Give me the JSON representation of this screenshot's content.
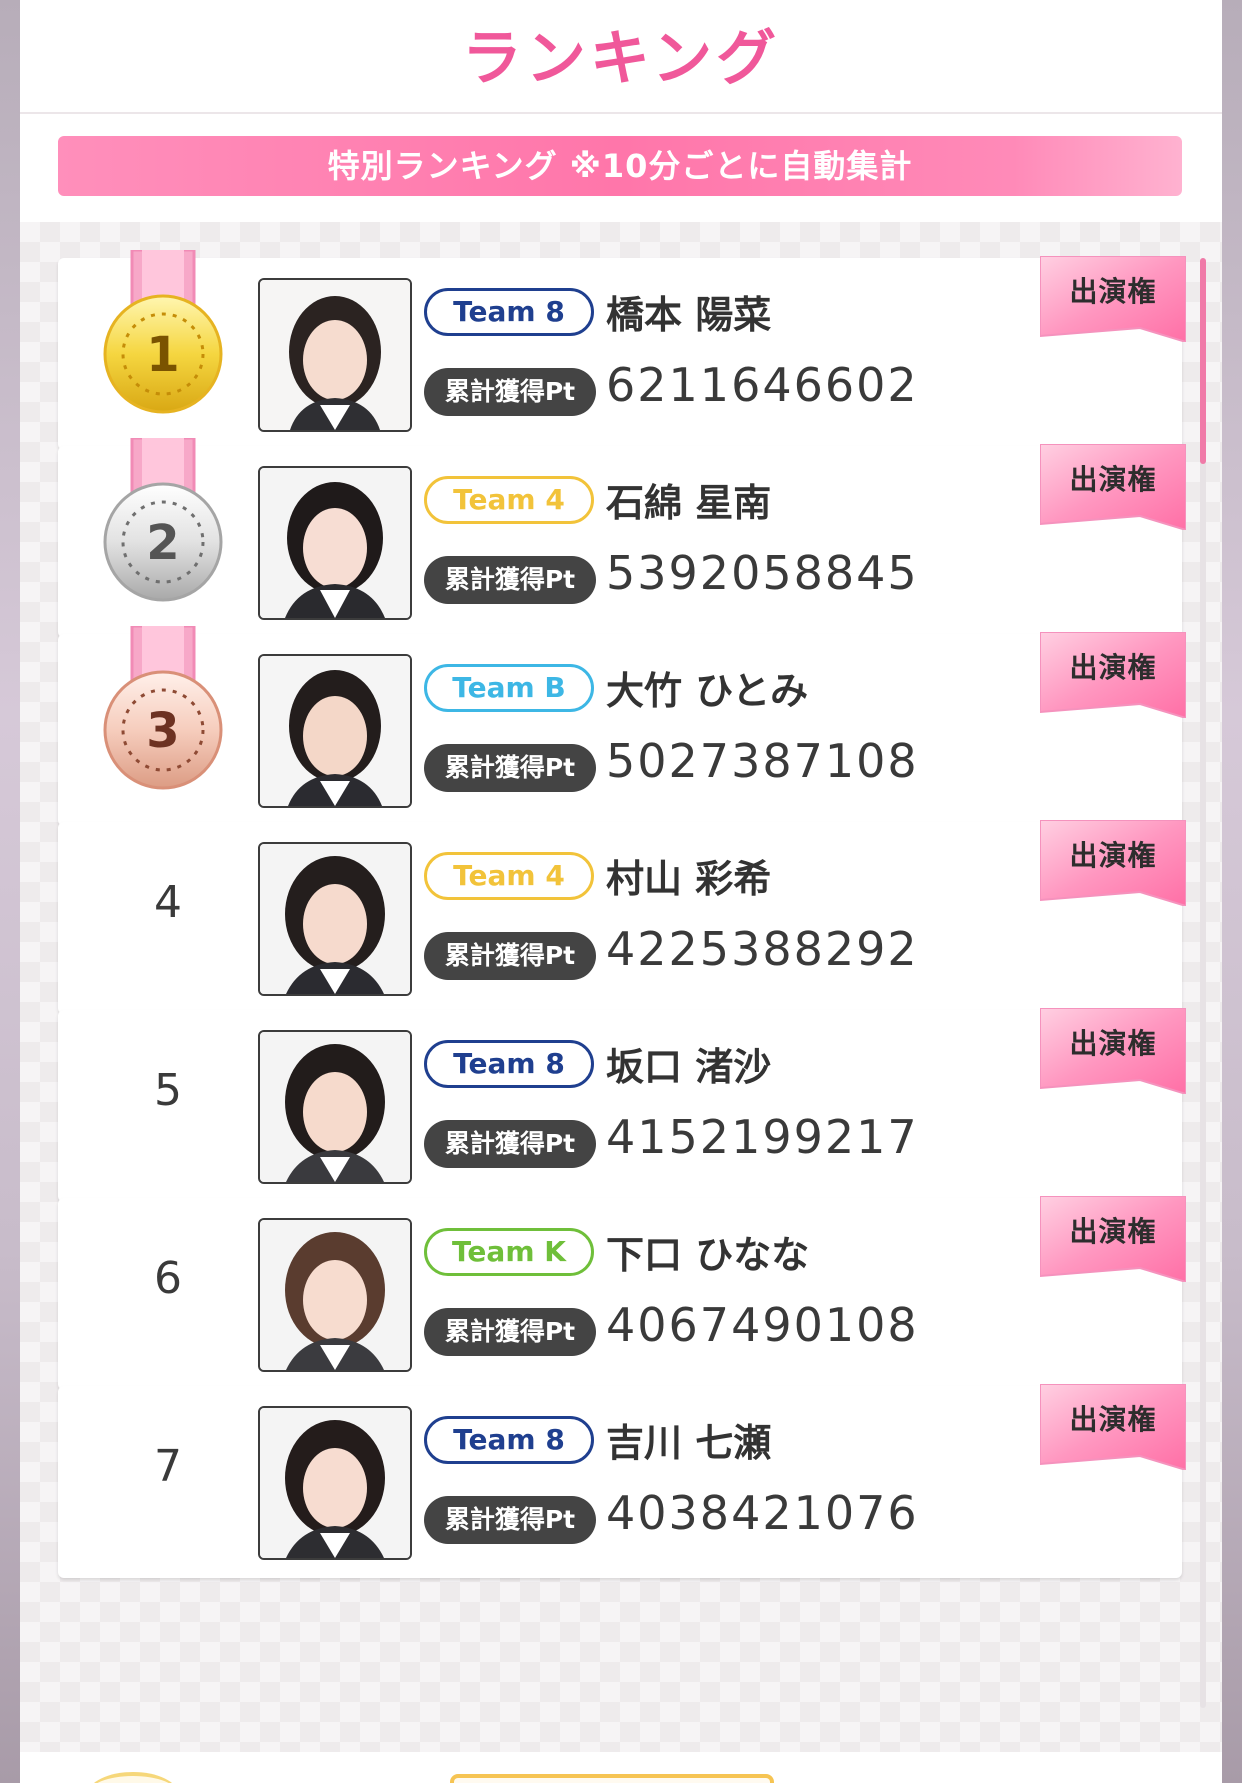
{
  "header": {
    "title": "ランキング"
  },
  "subheader": {
    "text": "特別ランキング ※10分ごとに自動集計"
  },
  "colors": {
    "accent_pink": "#f0589a",
    "team_8": "#1f3f8f",
    "team_4": "#f2c33a",
    "team_b": "#3db7e5",
    "team_k": "#6fbf3a"
  },
  "ranking": [
    {
      "rank": "1",
      "medal": "gold-medal-icon",
      "team": "Team 8",
      "name": "橋本 陽菜",
      "pt_label": "累計獲得Pt",
      "points": "6211646602",
      "ribbon": "出演権"
    },
    {
      "rank": "2",
      "medal": "silver-medal-icon",
      "team": "Team 4",
      "name": "石綿 星南",
      "pt_label": "累計獲得Pt",
      "points": "5392058845",
      "ribbon": "出演権"
    },
    {
      "rank": "3",
      "medal": "bronze-medal-icon",
      "team": "Team B",
      "name": "大竹 ひとみ",
      "pt_label": "累計獲得Pt",
      "points": "5027387108",
      "ribbon": "出演権"
    },
    {
      "rank": "4",
      "team": "Team 4",
      "name": "村山 彩希",
      "pt_label": "累計獲得Pt",
      "points": "4225388292",
      "ribbon": "出演権"
    },
    {
      "rank": "5",
      "team": "Team 8",
      "name": "坂口 渚沙",
      "pt_label": "累計獲得Pt",
      "points": "4152199217",
      "ribbon": "出演権"
    },
    {
      "rank": "6",
      "team": "Team K",
      "name": "下口 ひなな",
      "pt_label": "累計獲得Pt",
      "points": "4067490108",
      "ribbon": "出演権"
    },
    {
      "rank": "7",
      "team": "Team 8",
      "name": "吉川 七瀬",
      "pt_label": "累計獲得Pt",
      "points": "4038421076",
      "ribbon": "出演権"
    }
  ]
}
